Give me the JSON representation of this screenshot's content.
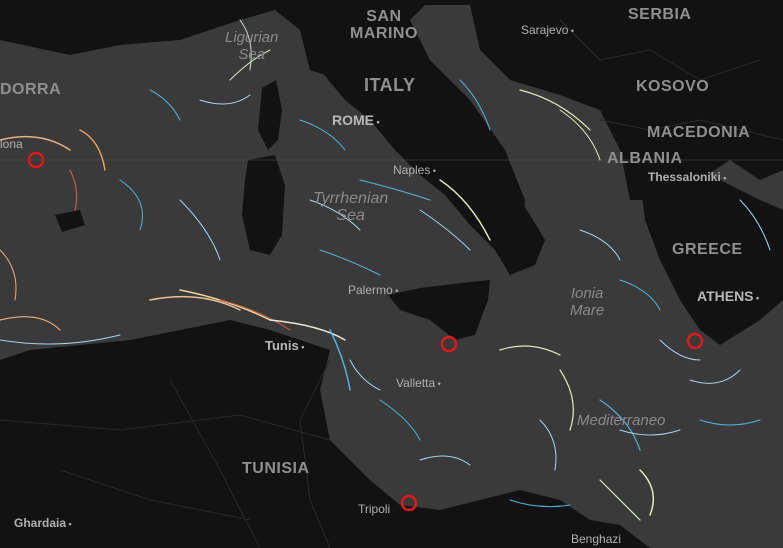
{
  "map": {
    "colors": {
      "land": "#121212",
      "sea": "#3a3a3a",
      "border": "#2a2a2a",
      "marker": "#e01818",
      "current_cool": "#4fb3d9",
      "current_warm": "#e8b07a"
    },
    "labels": {
      "san_marino": "SAN\nMARINO",
      "serbia": "SERBIA",
      "sarajevo": "Sarajevo",
      "andorra": "DORRA",
      "barcelona": "lona",
      "ligurian_sea": "Ligurian\nSea",
      "italy": "ITALY",
      "kosovo": "KOSOVO",
      "rome": "ROME",
      "macedonia": "MACEDONIA",
      "naples": "Naples",
      "albania": "ALBANIA",
      "thessaloniki": "Thessaloniki",
      "tyrrhenian_sea": "Tyrrhenian\nSea",
      "greece": "GREECE",
      "palermo": "Palermo",
      "ionian_sea": "Ionia\nMare",
      "athens": "ATHENS",
      "tunis": "Tunis",
      "valletta": "Valletta",
      "mediterranean": "Mediterraneo",
      "tunisia": "TUNISIA",
      "tripoli": "Tripoli",
      "ghardaia": "Ghardaia",
      "benghazi": "Benghazi"
    },
    "markers": [
      {
        "name": "marker-barcelona"
      },
      {
        "name": "marker-sicily"
      },
      {
        "name": "marker-athens"
      },
      {
        "name": "marker-tripoli"
      }
    ]
  }
}
